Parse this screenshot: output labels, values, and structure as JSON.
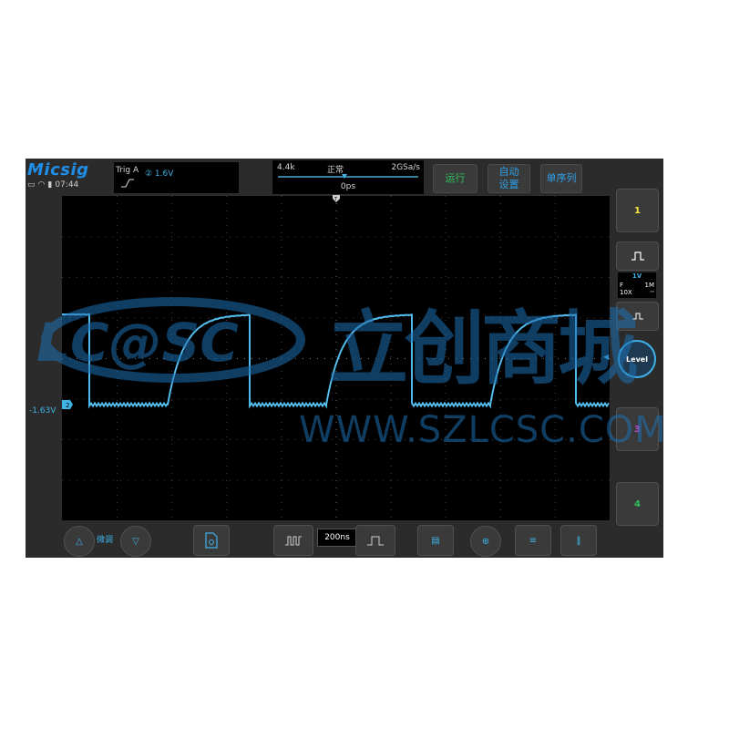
{
  "header": {
    "brand": "Micsig",
    "time": "07:44",
    "trigger": {
      "label": "Trig  A",
      "channel_level": "② 1.6V"
    },
    "timebase_panel": {
      "memory": "4.4k",
      "mode": "正常",
      "sample_rate": "2GSa/s",
      "position": "0ps"
    },
    "buttons": {
      "run": "运行",
      "auto_line1": "自动",
      "auto_line2": "设置",
      "single": "单序列"
    }
  },
  "side": {
    "ch1": "1",
    "ch2": {
      "volts": "1V",
      "coupling": "F",
      "impedance": "1M",
      "probe": "10X"
    },
    "ch3": "3",
    "ch4": "4",
    "level": "Level"
  },
  "screen": {
    "ch2_offset": "-1.63V",
    "ch2_marker": "2",
    "trigger_marker": "T"
  },
  "bottom": {
    "fine": "微调",
    "timebase": "200ns"
  },
  "watermark": {
    "cn": "立创商城",
    "url": "WWW.SZLCSC.COM",
    "logo": "LC@SC"
  },
  "colors": {
    "ch2": "#3fb2e8",
    "ch1": "#f5e642",
    "ch3": "#c34bd6",
    "ch4": "#2fc25b",
    "run": "#2fc25b",
    "watermark": "#1e6fb3"
  }
}
